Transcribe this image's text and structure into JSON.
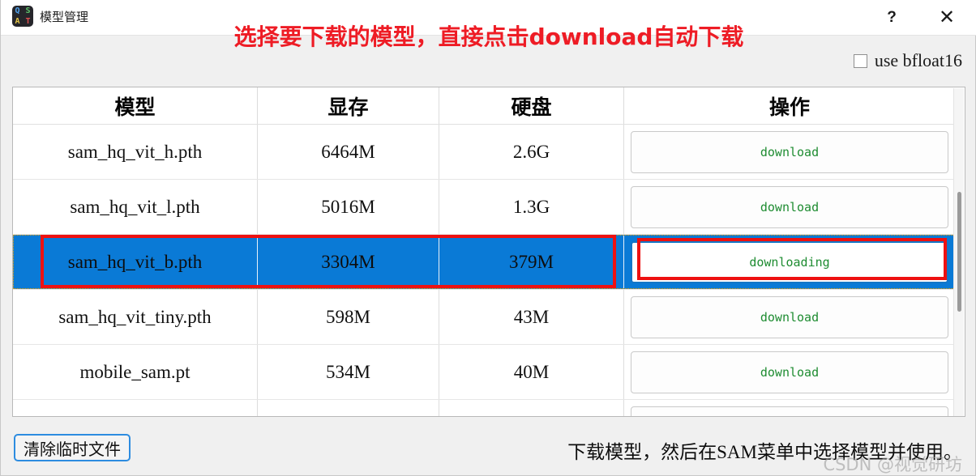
{
  "window": {
    "title": "模型管理",
    "icon_letters": [
      "Q",
      "S",
      "A",
      "T"
    ],
    "help_glyph": "?",
    "close_glyph": "✕"
  },
  "heading": "选择要下载的模型，直接点击download自动下载",
  "options": {
    "bfloat16_label": "use bfloat16",
    "bfloat16_checked": false
  },
  "table": {
    "columns": [
      "模型",
      "显存",
      "硬盘",
      "操作"
    ],
    "rows": [
      {
        "model": "sam_hq_vit_h.pth",
        "vram": "6464M",
        "disk": "2.6G",
        "action": "download",
        "selected": false
      },
      {
        "model": "sam_hq_vit_l.pth",
        "vram": "5016M",
        "disk": "1.3G",
        "action": "download",
        "selected": false
      },
      {
        "model": "sam_hq_vit_b.pth",
        "vram": "3304M",
        "disk": "379M",
        "action": "downloading",
        "selected": true
      },
      {
        "model": "sam_hq_vit_tiny.pth",
        "vram": "598M",
        "disk": "43M",
        "action": "download",
        "selected": false
      },
      {
        "model": "mobile_sam.pt",
        "vram": "534M",
        "disk": "40M",
        "action": "download",
        "selected": false
      },
      {
        "model": "",
        "vram": "",
        "disk": "",
        "action": "",
        "selected": false
      }
    ]
  },
  "footer": {
    "clear_temp_label": "清除临时文件",
    "status": "下载模型，然后在SAM菜单中选择模型并使用。"
  },
  "watermark": "CSDN @视觉研坊",
  "colors": {
    "heading_red": "#ee1c25",
    "selection_blue": "#0a7ad6",
    "annotation_red": "#ee1111",
    "download_green": "#1e8c31",
    "accent_blue": "#2d8ce0"
  }
}
